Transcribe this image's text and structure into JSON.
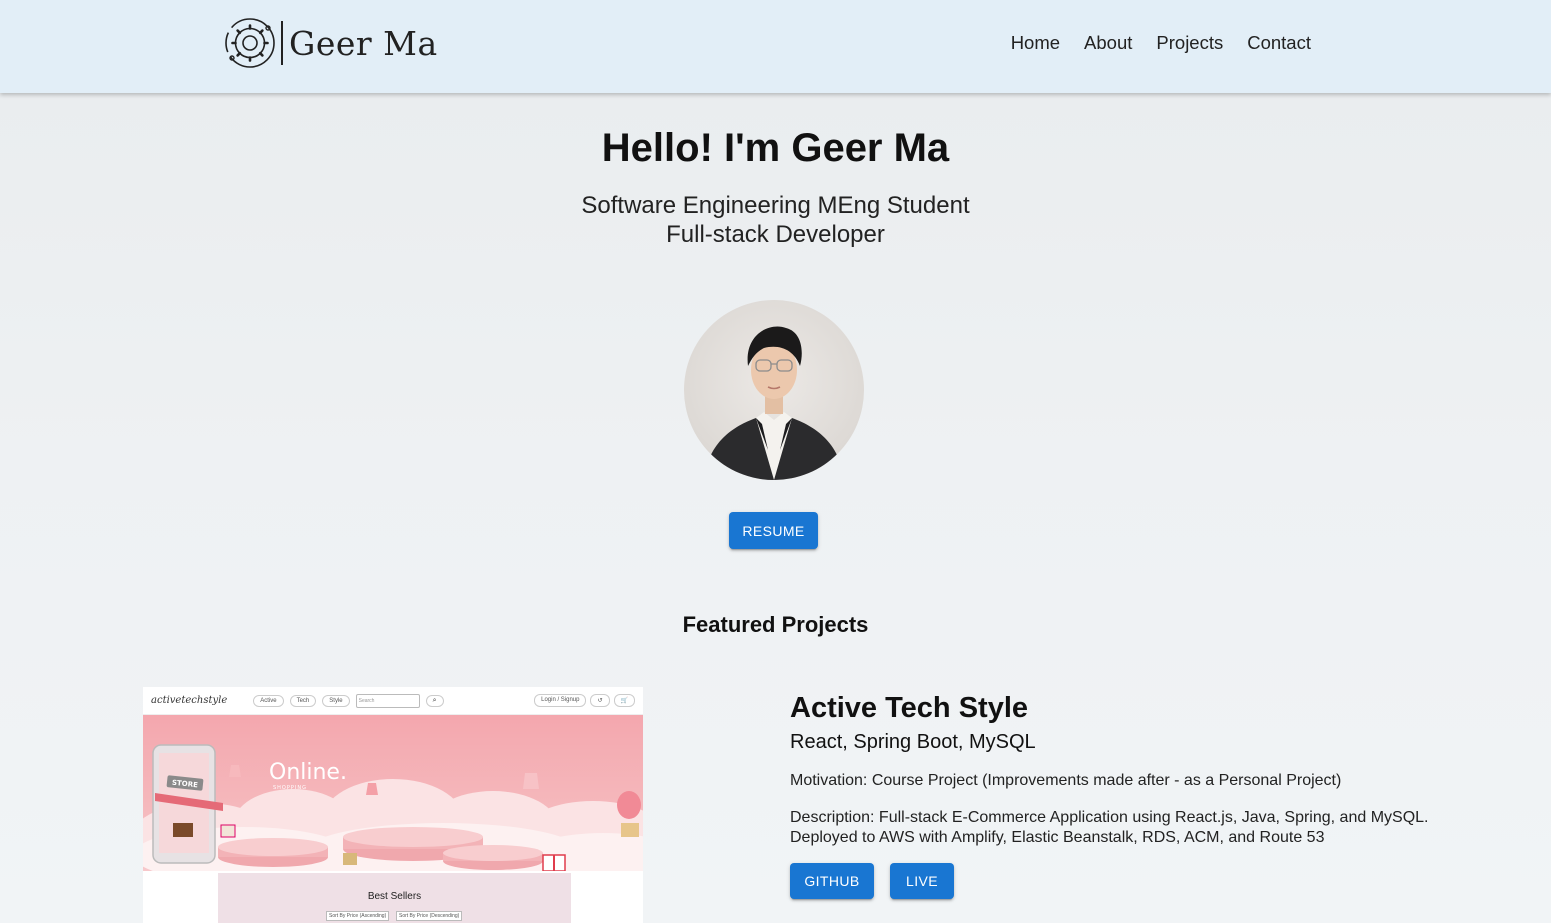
{
  "nav": {
    "brand": "Geer Ma",
    "links": [
      "Home",
      "About",
      "Projects",
      "Contact"
    ]
  },
  "hero": {
    "title": "Hello! I'm Geer Ma",
    "subtitle_1": "Software Engineering MEng Student",
    "subtitle_2": "Full-stack Developer",
    "resume_label": "RESUME"
  },
  "featured": {
    "heading": "Featured Projects",
    "project": {
      "title": "Active Tech Style",
      "tech": "React, Spring Boot, MySQL",
      "motivation": "Motivation: Course Project (Improvements made after - as a Personal Project)",
      "description": "Description: Full-stack E-Commerce Application using React.js, Java, Spring, and MySQL. Deployed to AWS with Amplify, Elastic Beanstalk, RDS, ACM, and Route 53",
      "github_label": "GITHUB",
      "live_label": "LIVE",
      "screenshot": {
        "logo": "activetechstyle",
        "nav_items": [
          "Active",
          "Tech",
          "Style"
        ],
        "search_placeholder": "Search",
        "login": "Login / Signup",
        "banner_title": "Online.",
        "banner_sub": "SHOPPING",
        "store_sign": "STORE",
        "section": "Best Sellers",
        "sort_asc": "Sort By Price (Ascending)",
        "sort_desc": "Sort By Price (Descending)"
      }
    }
  },
  "colors": {
    "navbar_bg": "#e2eef7",
    "button_primary": "#1976d2"
  }
}
